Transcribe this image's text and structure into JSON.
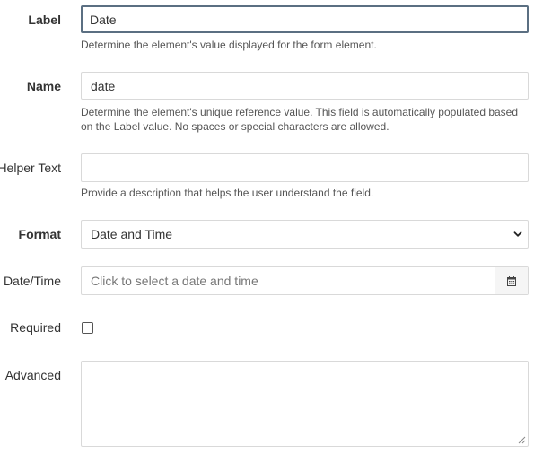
{
  "form": {
    "label": {
      "label": "Label",
      "value": "Date",
      "help": "Determine the element's value displayed for the form element."
    },
    "name": {
      "label": "Name",
      "value": "date",
      "help_line1": "Determine the element's unique reference value. This field is automatically populated based",
      "help_line2": "on the Label value. No spaces or special characters are allowed."
    },
    "helper_text": {
      "label": "Helper Text",
      "value": "",
      "help": "Provide a description that helps the user understand the field."
    },
    "format": {
      "label": "Format",
      "selected": "Date and Time"
    },
    "date_time": {
      "label": "Date/Time",
      "placeholder": "Click to select a date and time",
      "addon_icon": "calendar-icon"
    },
    "required": {
      "label": "Required",
      "checked": false
    },
    "advanced": {
      "label": "Advanced",
      "value": ""
    }
  },
  "colors": {
    "focus_border": "#5b6f82",
    "input_border": "#d9d9d9",
    "help_text": "#555555"
  }
}
